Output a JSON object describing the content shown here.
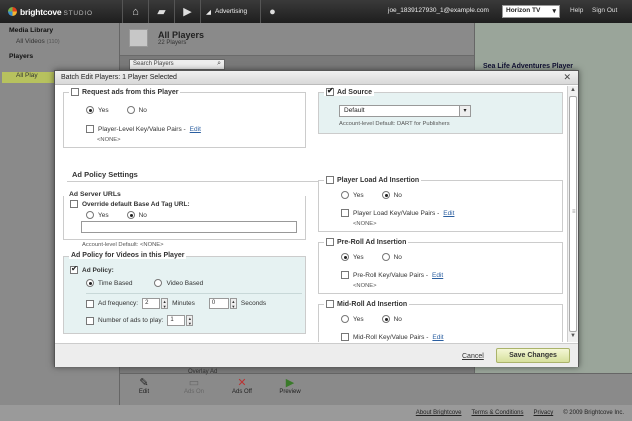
{
  "topbar": {
    "brand": "brightcove",
    "brand_suffix": "STUDIO",
    "advertising_label": "Advertising",
    "user_email": "joe_1839127930_1@example.com",
    "account": "Horizon TV",
    "help": "Help",
    "sign_out": "Sign Out"
  },
  "sidebar": {
    "media_library": "Media Library",
    "all_videos": "All Videos",
    "all_videos_count": "(110)",
    "players": "Players",
    "all_players": "All Play"
  },
  "main": {
    "title": "All Players",
    "subtitle": "22 Players",
    "search_placeholder": "Search Players",
    "right_title": "Sea Life Adventures Player",
    "bottom_label": "Overlay Ad",
    "actions": [
      "Edit",
      "Ads On",
      "Ads Off",
      "Preview"
    ]
  },
  "footer": {
    "about": "About Brightcove",
    "terms": "Terms & Conditions",
    "privacy": "Privacy",
    "copyright": "© 2009 Brightcove Inc."
  },
  "modal": {
    "title": "Batch Edit Players: 1 Player Selected",
    "request_ads": "Request ads from this Player",
    "yes": "Yes",
    "no": "No",
    "player_kv": "Player-Level Key/Value Pairs -",
    "edit": "Edit",
    "none": "<NONE>",
    "ad_source": "Ad Source",
    "ad_source_value": "Default",
    "ad_source_note": "Account-level Default: DART for Publishers",
    "ad_policy_settings": "Ad Policy Settings",
    "ad_server_urls": "Ad Server URLs",
    "override_tag": "Override default Base Ad Tag URL:",
    "account_default_none": "Account-level Default: <NONE>",
    "policy_videos": "Ad Policy for Videos in this Player",
    "ad_policy": "Ad Policy:",
    "time_based": "Time Based",
    "video_based": "Video Based",
    "ad_frequency": "Ad frequency:",
    "freq_minutes": "2",
    "minutes": "Minutes",
    "freq_seconds": "0",
    "seconds": "Seconds",
    "num_ads": "Number of ads to play:",
    "num_ads_value": "1",
    "player_load": "Player Load Ad Insertion",
    "player_load_kv": "Player Load Key/Value Pairs -",
    "pre_roll": "Pre-Roll Ad Insertion",
    "pre_roll_kv": "Pre-Roll Key/Value Pairs -",
    "mid_roll": "Mid-Roll Ad Insertion",
    "mid_roll_kv": "Mid-Roll Key/Value Pairs -",
    "cancel": "Cancel",
    "save": "Save Changes"
  }
}
